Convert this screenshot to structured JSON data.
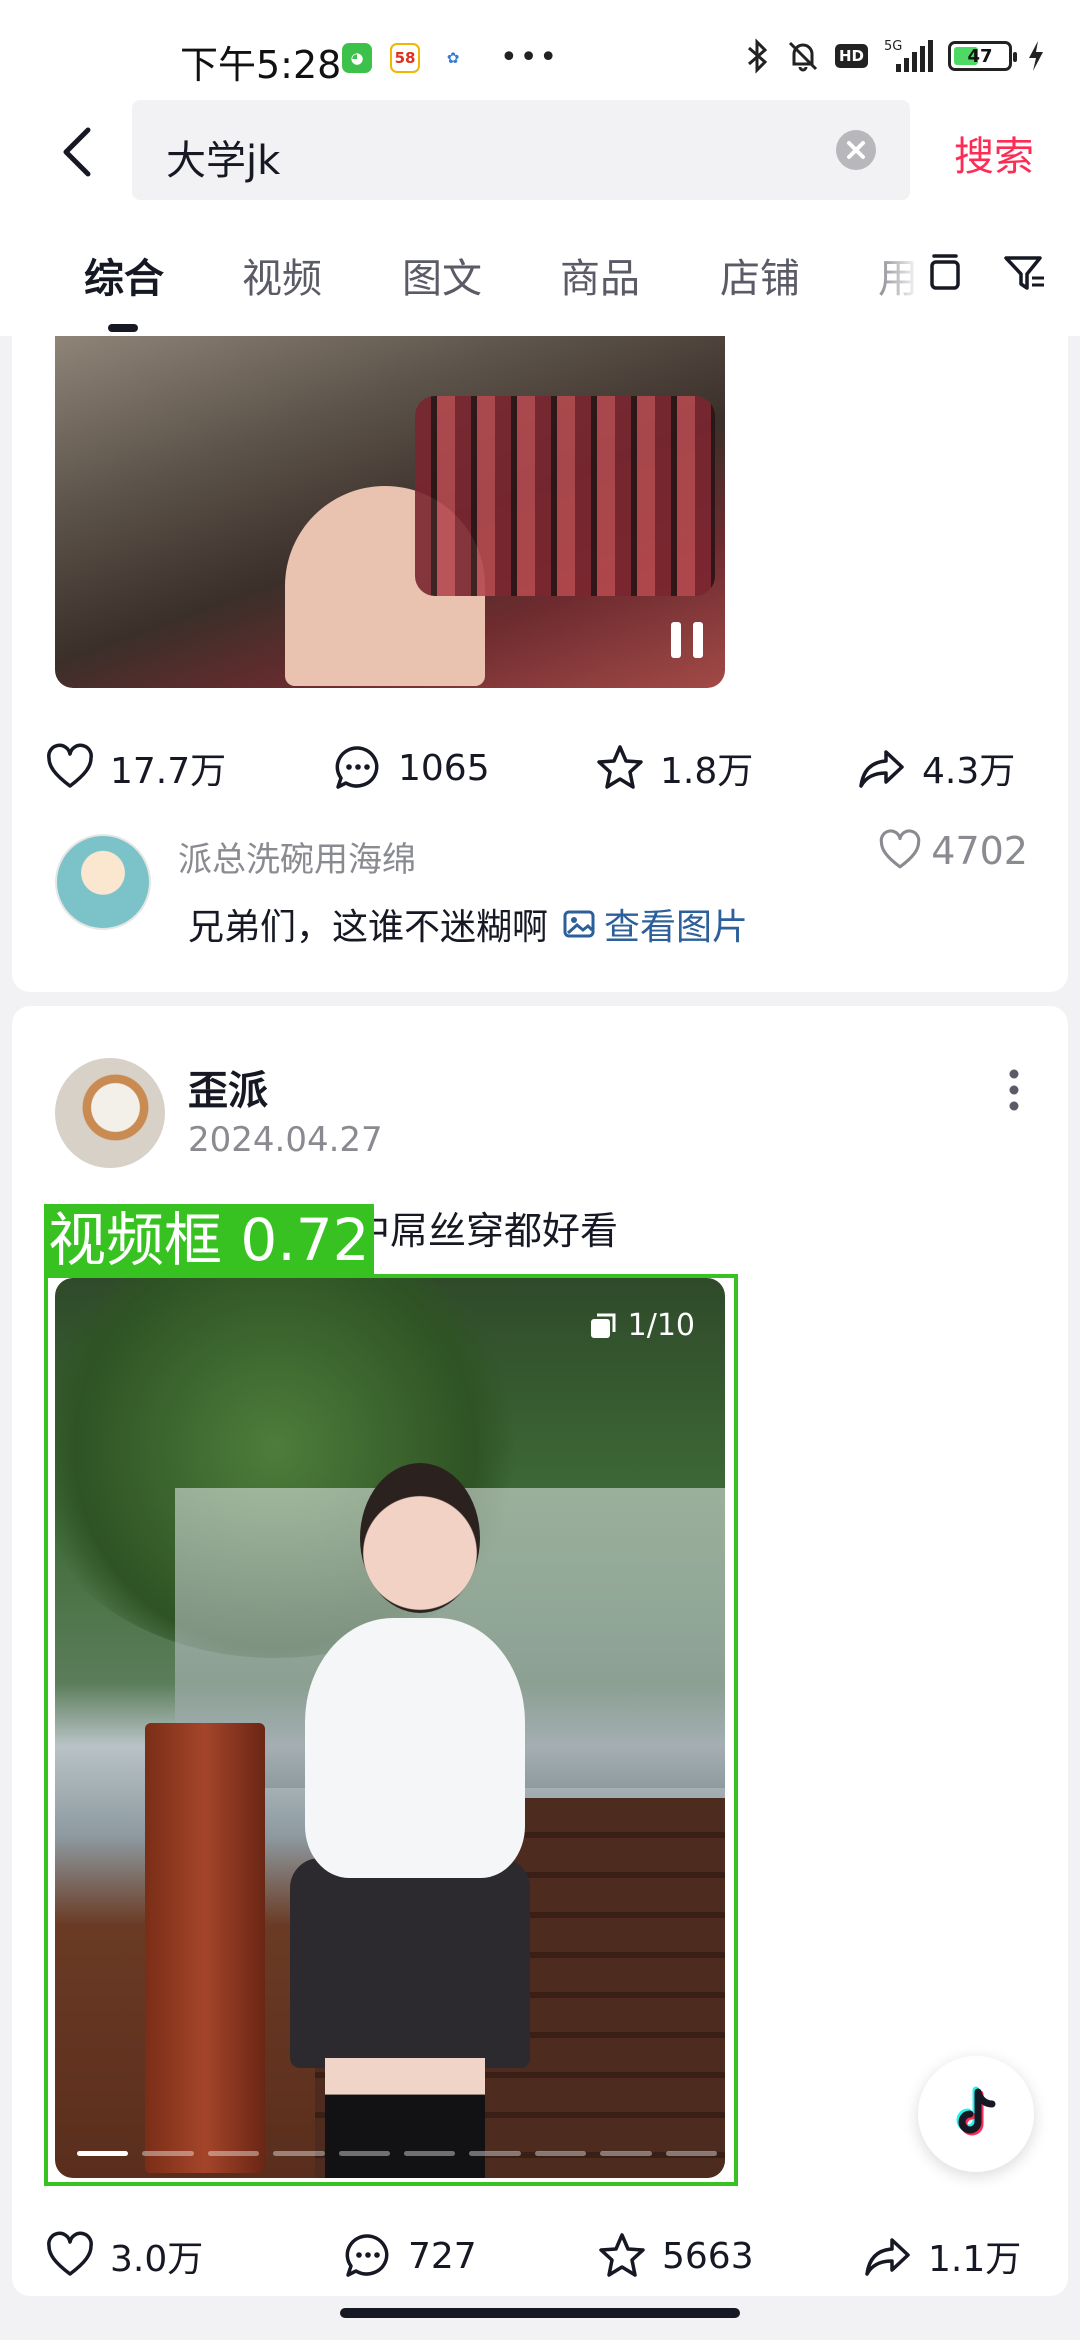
{
  "status_bar": {
    "time": "下午5:28",
    "network": "5G",
    "hd": "HD",
    "battery": "47",
    "battery_fraction": 0.47
  },
  "search": {
    "query": "大学jk",
    "button": "搜索"
  },
  "tabs": [
    {
      "label": "综合",
      "active": true
    },
    {
      "label": "视频"
    },
    {
      "label": "图文"
    },
    {
      "label": "商品"
    },
    {
      "label": "店铺"
    },
    {
      "label": "用"
    }
  ],
  "post1": {
    "stats": {
      "likes": "17.7万",
      "comments": "1065",
      "favorites": "1.8万",
      "shares": "4.3万"
    },
    "top_comment": {
      "author": "派总洗碗用海绵",
      "text": "兄弟们，这谁不迷糊啊",
      "link": "查看图片",
      "likes": "4702"
    }
  },
  "post2": {
    "author": "歪派",
    "date": "2024.04.27",
    "caption_visible": "中屌丝穿都好看",
    "image_counter": "1/10",
    "images_total": 10,
    "current_image": 1,
    "stats": {
      "likes": "3.0万",
      "comments": "727",
      "favorites": "5663",
      "shares": "1.1万"
    }
  },
  "detection": {
    "label": "视频框 0.72",
    "color": "#38c221"
  },
  "colors": {
    "accent": "#fe2c55",
    "link": "#2d5f9a"
  }
}
